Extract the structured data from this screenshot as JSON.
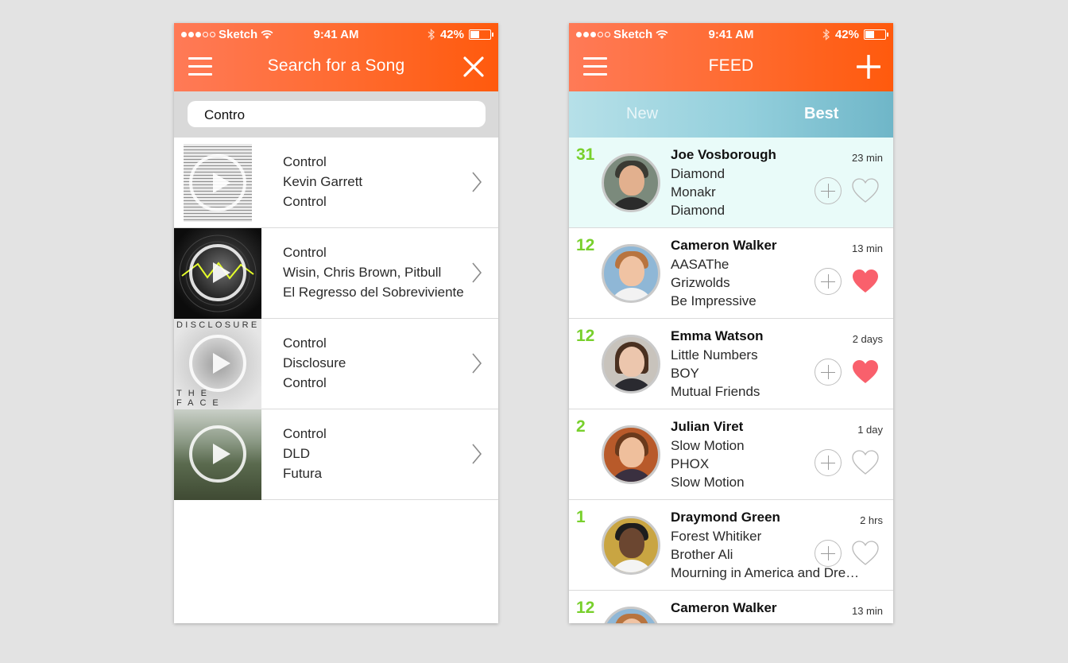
{
  "status": {
    "carrier": "Sketch",
    "time": "9:41 AM",
    "battery": "42%"
  },
  "search_screen": {
    "title": "Search for a Song",
    "query": "Contro",
    "results": [
      {
        "title": "Control",
        "artist": "Kevin Garrett",
        "album": "Control"
      },
      {
        "title": "Control",
        "artist": "Wisin, Chris Brown, Pitbull",
        "album": "El Regresso del Sobreviviente"
      },
      {
        "title": "Control",
        "artist": "Disclosure",
        "album": "Control",
        "art_top_text": "DISCLOSURE",
        "art_bottom_text": "THE FACE"
      },
      {
        "title": "Control",
        "artist": "DLD",
        "album": "Futura"
      }
    ]
  },
  "feed_screen": {
    "title": "FEED",
    "tabs": {
      "new": "New",
      "best": "Best",
      "active": "Best"
    },
    "items": [
      {
        "score": "31",
        "name": "Joe Vosborough",
        "line1": "Diamond",
        "line2": "Monakr",
        "line3": "Diamond",
        "time": "23 min",
        "liked": false
      },
      {
        "score": "12",
        "name": "Cameron Walker",
        "line1": "AASAThe",
        "line2": "Grizwolds",
        "line3": "Be Impressive",
        "time": "13 min",
        "liked": true
      },
      {
        "score": "12",
        "name": "Emma Watson",
        "line1": "Little Numbers",
        "line2": "BOY",
        "line3": "Mutual Friends",
        "time": "2 days",
        "liked": true
      },
      {
        "score": "2",
        "name": "Julian Viret",
        "line1": "Slow Motion",
        "line2": "PHOX",
        "line3": "Slow Motion",
        "time": "1 day",
        "liked": false
      },
      {
        "score": "1",
        "name": "Draymond Green",
        "line1": "Forest Whitiker",
        "line2": "Brother Ali",
        "line3": "Mourning in America and Dre…",
        "time": "2 hrs",
        "liked": false
      },
      {
        "score": "12",
        "name": "Cameron Walker",
        "time": "13 min"
      }
    ]
  },
  "colors": {
    "nav_orange": "#ff6a2e",
    "score_green": "#78d02c",
    "heart_red": "#f9606c",
    "tab_blue": "#93cfdc",
    "highlight_row": "#e9fbf9"
  },
  "icons": [
    "menu-icon",
    "close-icon",
    "plus-icon",
    "chevron-right-icon",
    "play-icon",
    "add-circle-icon",
    "heart-icon",
    "wifi-icon",
    "bluetooth-icon",
    "battery-icon"
  ]
}
